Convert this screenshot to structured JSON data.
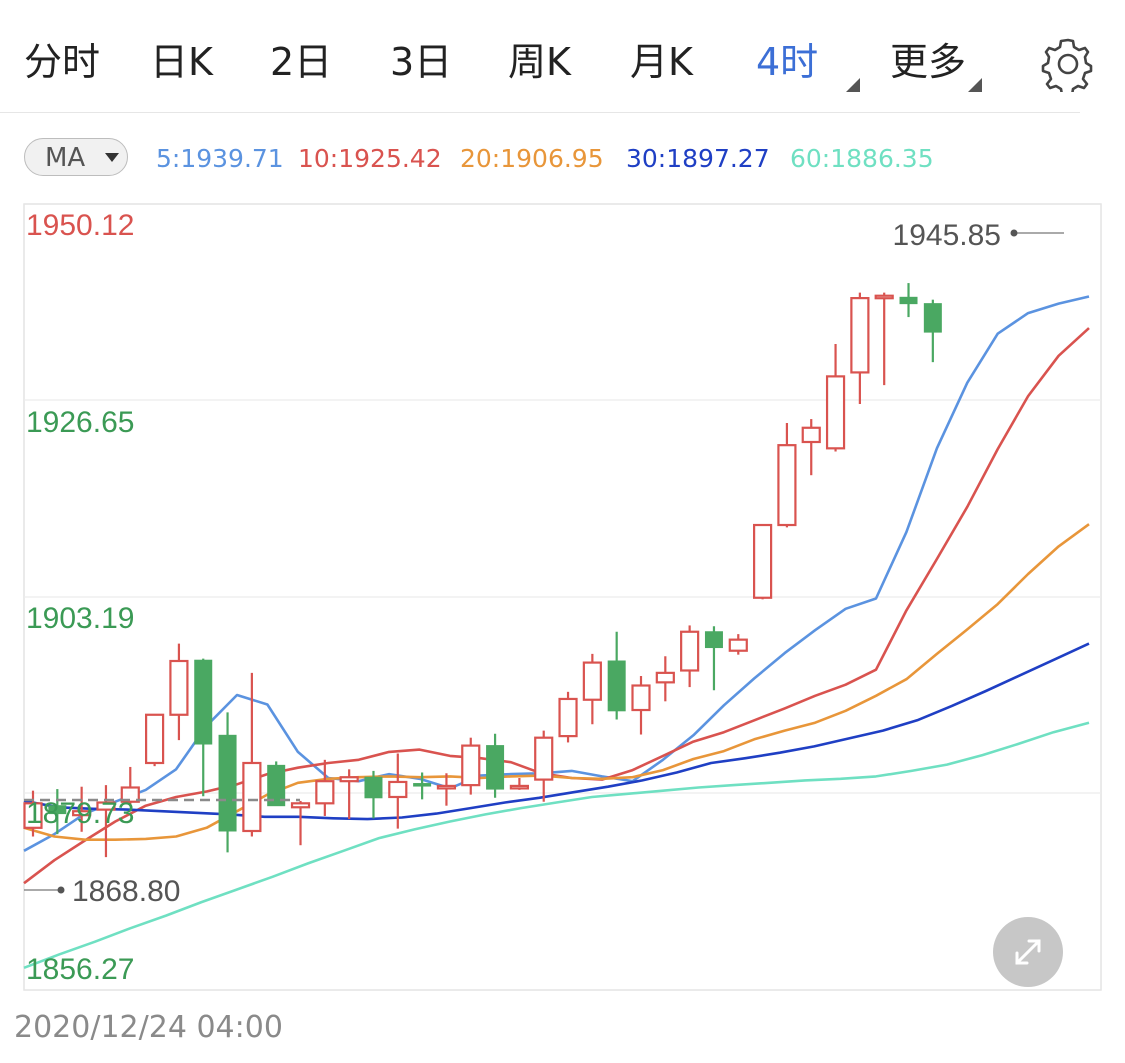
{
  "tabs": [
    {
      "label": "分时",
      "active": false
    },
    {
      "label": "日K",
      "active": false
    },
    {
      "label": "2日",
      "active": false
    },
    {
      "label": "3日",
      "active": false
    },
    {
      "label": "周K",
      "active": false
    },
    {
      "label": "月K",
      "active": false
    },
    {
      "label": "4时",
      "active": true
    },
    {
      "label": "更多",
      "active": false
    }
  ],
  "icons": {
    "settings": "gear-icon",
    "expand": "expand-arrows-icon",
    "dropdown": "caret-down-icon"
  },
  "ma_selector": {
    "label": "MA"
  },
  "ma_values": [
    {
      "text": "5:1939.71",
      "color": "#5b93e0"
    },
    {
      "text": "10:1925.42",
      "color": "#d9534f"
    },
    {
      "text": "20:1906.95",
      "color": "#e8963a"
    },
    {
      "text": "30:1897.27",
      "color": "#1f3fc4"
    },
    {
      "text": "60:1886.35",
      "color": "#6fe0c2"
    }
  ],
  "date_label": "2020/12/24 04:00",
  "colors": {
    "up": "#d9534f",
    "down": "#4aa862",
    "price_label_red": "#d9534f",
    "price_label_green": "#3b9a55",
    "dashed": "#8a8a8a"
  },
  "chart_data": {
    "type": "candlestick",
    "ylim": [
      1856.27,
      1950.12
    ],
    "y_tick_labels": [
      "1950.12",
      "1926.65",
      "1903.19",
      "1879.73",
      "1856.27"
    ],
    "high_marker": "1945.85",
    "low_marker": "1868.80",
    "current_price_line": 1879.73,
    "candles": [
      {
        "o": 1874.0,
        "h": 1878.7,
        "l": 1872.9,
        "c": 1877.1
      },
      {
        "o": 1876.8,
        "h": 1878.9,
        "l": 1873.2,
        "c": 1875.8
      },
      {
        "o": 1875.6,
        "h": 1879.2,
        "l": 1873.5,
        "c": 1876.1
      },
      {
        "o": 1876.3,
        "h": 1879.4,
        "l": 1870.3,
        "c": 1877.2
      },
      {
        "o": 1877.3,
        "h": 1881.7,
        "l": 1876.8,
        "c": 1879.1
      },
      {
        "o": 1882.2,
        "h": 1886.4,
        "l": 1881.8,
        "c": 1888.3
      },
      {
        "o": 1888.3,
        "h": 1897.3,
        "l": 1885.1,
        "c": 1895.1
      },
      {
        "o": 1895.2,
        "h": 1895.4,
        "l": 1878.0,
        "c": 1884.6
      },
      {
        "o": 1885.7,
        "h": 1888.6,
        "l": 1870.9,
        "c": 1873.6
      },
      {
        "o": 1873.6,
        "h": 1893.6,
        "l": 1872.9,
        "c": 1882.2
      },
      {
        "o": 1881.9,
        "h": 1882.4,
        "l": 1876.8,
        "c": 1876.8
      },
      {
        "o": 1876.6,
        "h": 1877.4,
        "l": 1871.8,
        "c": 1877.1
      },
      {
        "o": 1877.1,
        "h": 1882.6,
        "l": 1875.5,
        "c": 1879.9
      },
      {
        "o": 1879.9,
        "h": 1881.4,
        "l": 1875.1,
        "c": 1880.4
      },
      {
        "o": 1880.4,
        "h": 1881.2,
        "l": 1875.2,
        "c": 1877.8
      },
      {
        "o": 1877.9,
        "h": 1883.4,
        "l": 1873.9,
        "c": 1879.8
      },
      {
        "o": 1879.6,
        "h": 1881.0,
        "l": 1877.6,
        "c": 1879.4
      },
      {
        "o": 1879.1,
        "h": 1880.9,
        "l": 1876.8,
        "c": 1879.3
      },
      {
        "o": 1879.4,
        "h": 1885.4,
        "l": 1878.2,
        "c": 1884.4
      },
      {
        "o": 1884.4,
        "h": 1885.9,
        "l": 1877.8,
        "c": 1878.9
      },
      {
        "o": 1879.2,
        "h": 1880.3,
        "l": 1878.8,
        "c": 1879.3
      },
      {
        "o": 1880.1,
        "h": 1886.3,
        "l": 1877.3,
        "c": 1885.4
      },
      {
        "o": 1885.6,
        "h": 1891.2,
        "l": 1884.8,
        "c": 1890.3
      },
      {
        "o": 1890.2,
        "h": 1896.0,
        "l": 1887.1,
        "c": 1894.9
      },
      {
        "o": 1895.1,
        "h": 1898.8,
        "l": 1887.7,
        "c": 1888.8
      },
      {
        "o": 1888.9,
        "h": 1893.2,
        "l": 1885.8,
        "c": 1892.0
      },
      {
        "o": 1892.4,
        "h": 1895.7,
        "l": 1890.0,
        "c": 1893.6
      },
      {
        "o": 1893.9,
        "h": 1899.6,
        "l": 1891.8,
        "c": 1898.8
      },
      {
        "o": 1898.8,
        "h": 1899.5,
        "l": 1891.4,
        "c": 1896.8
      },
      {
        "o": 1896.4,
        "h": 1898.5,
        "l": 1895.9,
        "c": 1897.8
      },
      {
        "o": 1903.1,
        "h": 1906.1,
        "l": 1902.9,
        "c": 1912.3
      },
      {
        "o": 1912.3,
        "h": 1925.2,
        "l": 1912.0,
        "c": 1922.4
      },
      {
        "o": 1922.8,
        "h": 1925.7,
        "l": 1918.6,
        "c": 1924.6
      },
      {
        "o": 1922.0,
        "h": 1935.2,
        "l": 1921.6,
        "c": 1931.1
      },
      {
        "o": 1931.6,
        "h": 1941.7,
        "l": 1927.6,
        "c": 1941.0
      },
      {
        "o": 1941.1,
        "h": 1941.7,
        "l": 1930.0,
        "c": 1941.3
      },
      {
        "o": 1941.1,
        "h": 1942.9,
        "l": 1938.6,
        "c": 1940.3
      },
      {
        "o": 1940.3,
        "h": 1940.8,
        "l": 1932.9,
        "c": 1936.7
      }
    ],
    "ma_lines": [
      {
        "name": "5",
        "color": "#5b93e0",
        "points": [
          1871.1,
          1873.2,
          1875.8,
          1877.3,
          1878.8,
          1881.4,
          1886.9,
          1890.8,
          1889.6,
          1883.6,
          1880.3,
          1879.9,
          1880.8,
          1880.2,
          1879.0,
          1880.6,
          1880.8,
          1880.9,
          1881.2,
          1880.5,
          1879.9,
          1882.6,
          1885.7,
          1889.5,
          1892.9,
          1896.1,
          1899.0,
          1901.7,
          1903.0,
          1911.4,
          1922.0,
          1930.3,
          1936.5,
          1939.1,
          1940.3,
          1941.2
        ]
      },
      {
        "name": "10",
        "color": "#d9534f",
        "points": [
          1867.0,
          1869.9,
          1872.4,
          1874.8,
          1876.8,
          1877.9,
          1878.6,
          1879.5,
          1880.8,
          1881.6,
          1882.2,
          1882.6,
          1883.6,
          1883.9,
          1883.1,
          1882.8,
          1882.3,
          1880.9,
          1880.3,
          1880.1,
          1881.3,
          1883.1,
          1884.9,
          1886.1,
          1887.6,
          1889.1,
          1890.7,
          1892.1,
          1894.0,
          1901.5,
          1908.0,
          1914.6,
          1921.9,
          1928.6,
          1933.7,
          1937.2
        ]
      },
      {
        "name": "20",
        "color": "#e8963a",
        "points": [
          1874.0,
          1872.9,
          1872.5,
          1872.5,
          1872.6,
          1872.9,
          1874.0,
          1876.1,
          1878.2,
          1879.7,
          1880.2,
          1880.4,
          1880.5,
          1880.4,
          1880.5,
          1880.3,
          1880.5,
          1880.6,
          1880.3,
          1880.2,
          1880.4,
          1881.3,
          1882.7,
          1883.7,
          1885.2,
          1886.3,
          1887.3,
          1888.8,
          1890.7,
          1892.8,
          1896.0,
          1899.1,
          1902.3,
          1906.1,
          1909.6,
          1912.4
        ]
      },
      {
        "name": "30",
        "color": "#1f3fc4",
        "points": [
          1877.4,
          1876.6,
          1876.4,
          1876.3,
          1876.1,
          1875.9,
          1875.7,
          1875.4,
          1875.4,
          1875.2,
          1875.1,
          1875.3,
          1875.8,
          1876.5,
          1877.2,
          1877.8,
          1878.5,
          1879.2,
          1880.0,
          1881.0,
          1882.2,
          1882.8,
          1883.5,
          1884.3,
          1885.3,
          1886.3,
          1887.6,
          1889.4,
          1891.3,
          1893.3,
          1895.3,
          1897.3
        ]
      },
      {
        "name": "60",
        "color": "#6fe0c2",
        "points": [
          1856.3,
          1858.0,
          1859.6,
          1861.3,
          1862.9,
          1864.6,
          1866.2,
          1867.8,
          1869.5,
          1871.1,
          1872.7,
          1873.8,
          1874.8,
          1875.7,
          1876.5,
          1877.2,
          1877.9,
          1878.3,
          1878.7,
          1879.1,
          1879.4,
          1879.7,
          1880.0,
          1880.2,
          1880.5,
          1881.2,
          1882.0,
          1883.2,
          1884.6,
          1886.1,
          1887.3
        ]
      }
    ]
  }
}
